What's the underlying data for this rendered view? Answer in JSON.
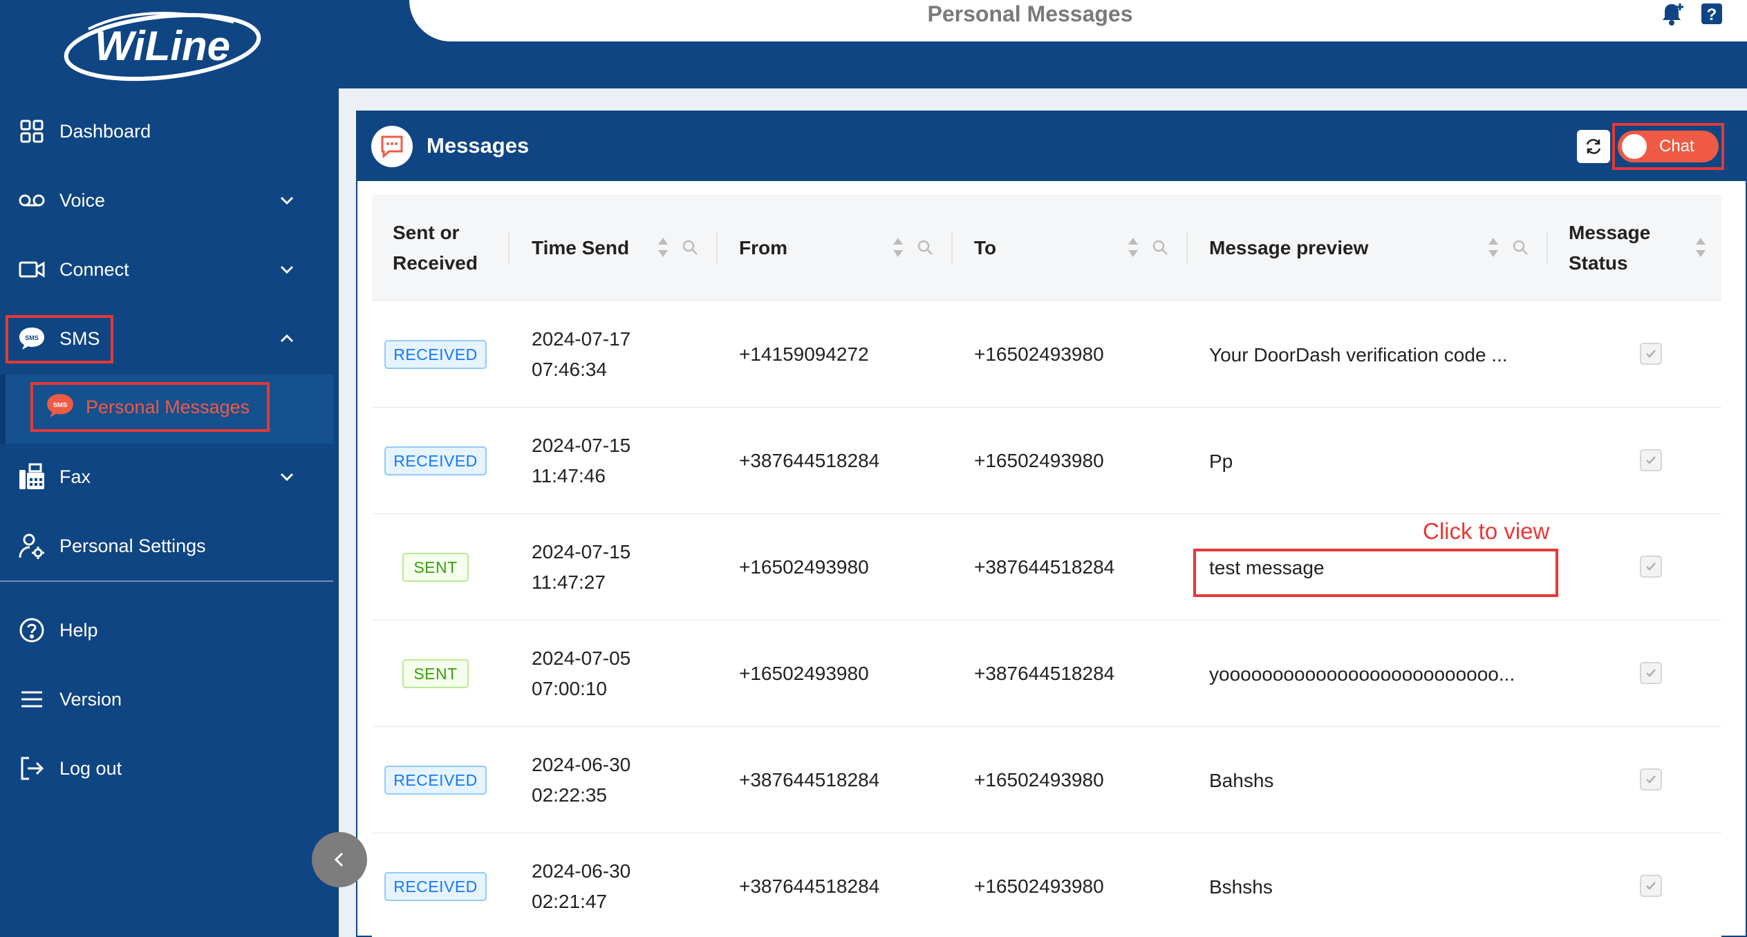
{
  "brand": {
    "logo_text": "WiLine"
  },
  "header": {
    "title": "Personal Messages",
    "icons": [
      "bell-plus-icon",
      "help-icon"
    ]
  },
  "sidebar": {
    "items": [
      {
        "label": "Dashboard",
        "icon": "grid-icon"
      },
      {
        "label": "Voice",
        "icon": "voicemail-icon",
        "expandable": true
      },
      {
        "label": "Connect",
        "icon": "video-icon",
        "expandable": true
      },
      {
        "label": "SMS",
        "icon": "sms-icon",
        "expanded": true
      },
      {
        "label": "Personal Messages",
        "icon": "sms-icon",
        "active": true
      },
      {
        "label": "Fax",
        "icon": "fax-icon",
        "expandable": true
      },
      {
        "label": "Personal Settings",
        "icon": "user-gear-icon"
      },
      {
        "label": "Help",
        "icon": "help-circle-icon"
      },
      {
        "label": "Version",
        "icon": "menu-icon"
      },
      {
        "label": "Log out",
        "icon": "logout-icon"
      }
    ]
  },
  "card": {
    "title": "Messages",
    "chat_label": "Chat",
    "chat_toggle_on": true
  },
  "table": {
    "columns": [
      {
        "label1": "Sent or",
        "label2": "Received"
      },
      {
        "label": "Time Send"
      },
      {
        "label": "From"
      },
      {
        "label": "To"
      },
      {
        "label": "Message preview"
      },
      {
        "label1": "Message",
        "label2": "Status"
      }
    ],
    "rows": [
      {
        "type": "RECEIVED",
        "date": "2024-07-17",
        "time": "07:46:34",
        "from": "+14159094272",
        "to": "+16502493980",
        "preview": "Your DoorDash verification code ..."
      },
      {
        "type": "RECEIVED",
        "date": "2024-07-15",
        "time": "11:47:46",
        "from": "+387644518284",
        "to": "+16502493980",
        "preview": "Pp"
      },
      {
        "type": "SENT",
        "date": "2024-07-15",
        "time": "11:47:27",
        "from": "+16502493980",
        "to": "+387644518284",
        "preview": "test message"
      },
      {
        "type": "SENT",
        "date": "2024-07-05",
        "time": "07:00:10",
        "from": "+16502493980",
        "to": "+387644518284",
        "preview": "yoooooooooooooooooooooooooo..."
      },
      {
        "type": "RECEIVED",
        "date": "2024-06-30",
        "time": "02:22:35",
        "from": "+387644518284",
        "to": "+16502493980",
        "preview": "Bahshs"
      },
      {
        "type": "RECEIVED",
        "date": "2024-06-30",
        "time": "02:21:47",
        "from": "+387644518284",
        "to": "+16502493980",
        "preview": "Bshshs"
      }
    ]
  },
  "annotation": {
    "text": "Click to view"
  },
  "colors": {
    "sidebar": "#0f4582",
    "accent": "#ef5a45",
    "highlight": "#e53935"
  }
}
